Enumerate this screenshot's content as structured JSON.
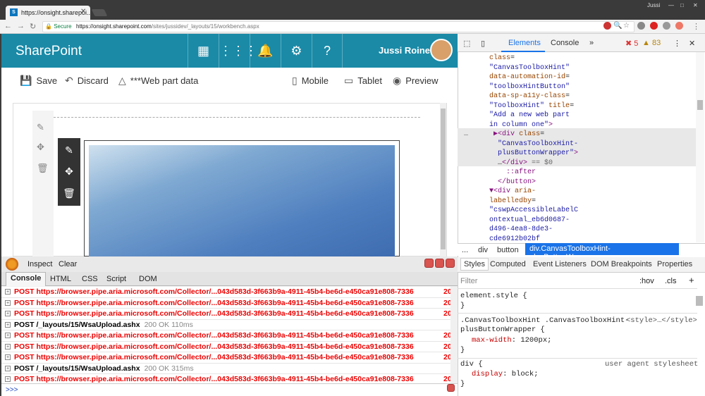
{
  "browser": {
    "tab_title": "https://onsight.sharepoi...",
    "window_user": "Jussi",
    "secure_label": "Secure",
    "url_prefix": "https://onsight.sharepoint.com",
    "url_path": "/sites/jussidev/_layouts/15/workbench.aspx"
  },
  "sharepoint": {
    "brand": "SharePoint",
    "user_name": "Jussi Roine",
    "commands": {
      "save": "Save",
      "discard": "Discard",
      "webpart_data": "***Web part data",
      "mobile": "Mobile",
      "tablet": "Tablet",
      "preview": "Preview"
    }
  },
  "devtools": {
    "tabs": {
      "elements": "Elements",
      "console": "Console"
    },
    "errors": "5",
    "warnings": "83",
    "breadcrumbs": [
      "...",
      "div",
      "button",
      "div.CanvasToolboxHint-plusButtonWrapper"
    ],
    "styles_tabs": [
      "Styles",
      "Computed",
      "Event Listeners",
      "DOM Breakpoints",
      "Properties"
    ],
    "filter_placeholder": "Filter",
    "hov": ":hov",
    "cls": ".cls",
    "rule1": "element.style {",
    "rule1_end": "}",
    "rule2_selector": ".CanvasToolboxHint .CanvasToolboxHint-",
    "rule2_selector2": "plusButtonWrapper {",
    "rule2_source": "<style>…</style>",
    "rule2_prop": "max-width",
    "rule2_val": "1200px;",
    "rule2_end": "}",
    "rule3_selector": "div {",
    "rule3_source": "user agent stylesheet",
    "rule3_prop": "display",
    "rule3_val": "block;",
    "rule3_end": "}"
  },
  "firebug": {
    "inspect": "Inspect",
    "clear": "Clear",
    "tabs": [
      "Console",
      "HTML",
      "CSS",
      "Script",
      "DOM"
    ],
    "prompt": ">>>",
    "rows": [
      {
        "type": "err",
        "text": "POST https://browser.pipe.aria.microsoft.com/Collector/...043d583d-3f663b9a-4911-45b4-be6d-e450ca91e808-7336",
        "tail": "20"
      },
      {
        "type": "err",
        "text": "POST https://browser.pipe.aria.microsoft.com/Collector/...043d583d-3f663b9a-4911-45b4-be6d-e450ca91e808-7336",
        "tail": "20"
      },
      {
        "type": "err",
        "text": "POST https://browser.pipe.aria.microsoft.com/Collector/...043d583d-3f663b9a-4911-45b4-be6d-e450ca91e808-7336",
        "tail": "20"
      },
      {
        "type": "ok",
        "text": "POST /_layouts/15/WsaUpload.ashx",
        "status": "200 OK 110ms"
      },
      {
        "type": "err",
        "text": "POST https://browser.pipe.aria.microsoft.com/Collector/...043d583d-3f663b9a-4911-45b4-be6d-e450ca91e808-7336",
        "tail": "20"
      },
      {
        "type": "err",
        "text": "POST https://browser.pipe.aria.microsoft.com/Collector/...043d583d-3f663b9a-4911-45b4-be6d-e450ca91e808-7336",
        "tail": "20"
      },
      {
        "type": "err",
        "text": "POST https://browser.pipe.aria.microsoft.com/Collector/...043d583d-3f663b9a-4911-45b4-be6d-e450ca91e808-7336",
        "tail": "20"
      },
      {
        "type": "ok",
        "text": "POST /_layouts/15/WsaUpload.ashx",
        "status": "200 OK 315ms"
      },
      {
        "type": "err",
        "text": "POST https://browser.pipe.aria.microsoft.com/Collector/...043d583d-3f663b9a-4911-45b4-be6d-e450ca91e808-7336",
        "tail": "20"
      }
    ]
  }
}
